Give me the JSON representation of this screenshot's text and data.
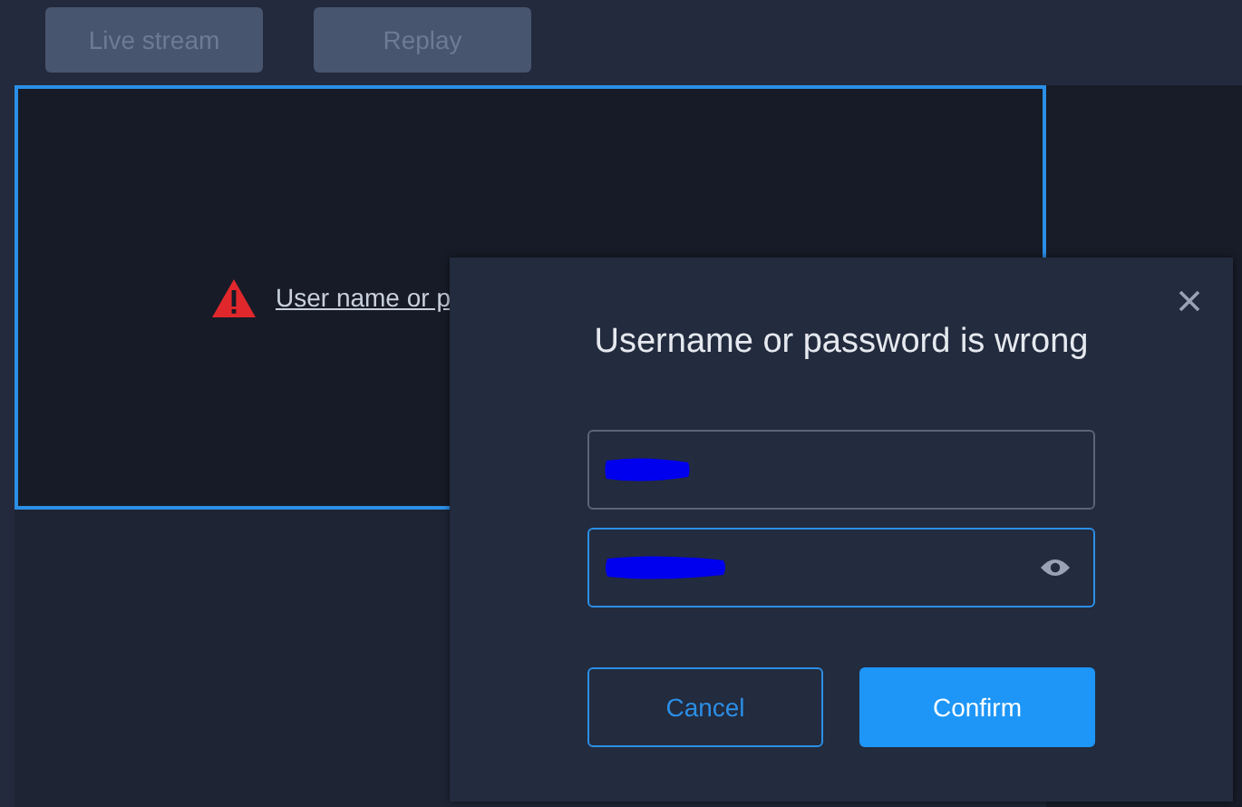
{
  "tabs": [
    {
      "label": "Live stream",
      "disabled": true
    },
    {
      "label": "Replay",
      "disabled": true
    }
  ],
  "video_panel": {
    "error": "User name or p"
  },
  "dialog": {
    "title": "Username or password is wrong",
    "fields": [
      {
        "kind": "text",
        "focused": false
      },
      {
        "kind": "password",
        "focused": true
      }
    ],
    "buttons": [
      {
        "label": "Cancel",
        "kind": "secondary"
      },
      {
        "label": "Confirm",
        "kind": "primary"
      }
    ]
  }
}
